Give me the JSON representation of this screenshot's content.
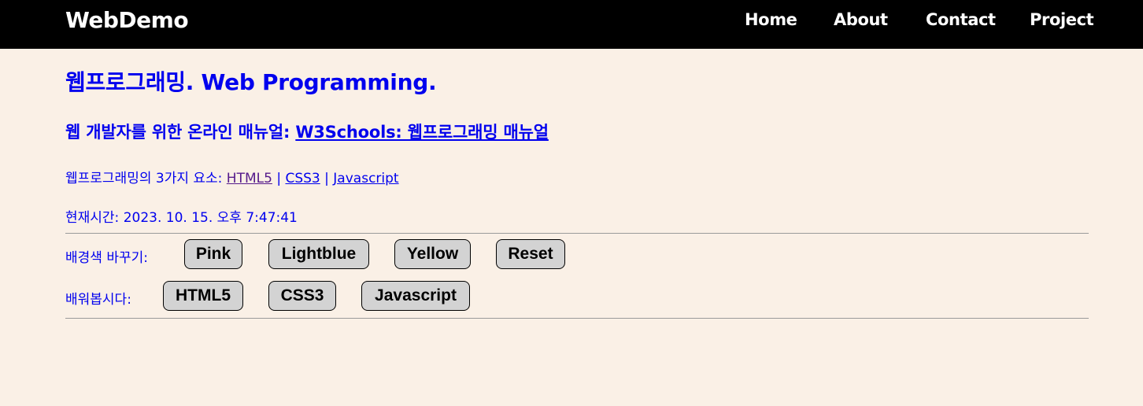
{
  "navbar": {
    "brand": "WebDemo",
    "items": [
      "Home",
      "About",
      "Contact",
      "Project"
    ]
  },
  "main": {
    "heading": "웹프로그래밍. Web Programming.",
    "subheading_text": "웹 개발자를 위한 온라인 매뉴얼: ",
    "subheading_link": "W3Schools: 웹프로그래밍 매뉴얼",
    "elements_label": "웹프로그래밍의 3가지 요소: ",
    "elements_links": [
      "HTML5",
      "CSS3",
      "Javascript"
    ],
    "separator": " | ",
    "clock_label": "현재시간: ",
    "clock_value": "2023. 10. 15. 오후 7:47:41",
    "bg_label": "배경색 바꾸기:",
    "bg_buttons": [
      "Pink",
      "Lightblue",
      "Yellow",
      "Reset"
    ],
    "learn_label": "배워봅시다:",
    "learn_buttons": [
      "HTML5",
      "CSS3",
      "Javascript"
    ]
  },
  "colors": {
    "background": "#FAF0E6",
    "navbar": "#000000",
    "link": "#0000EE",
    "visited_link": "#551A8B",
    "button": "#D3D3D3"
  }
}
